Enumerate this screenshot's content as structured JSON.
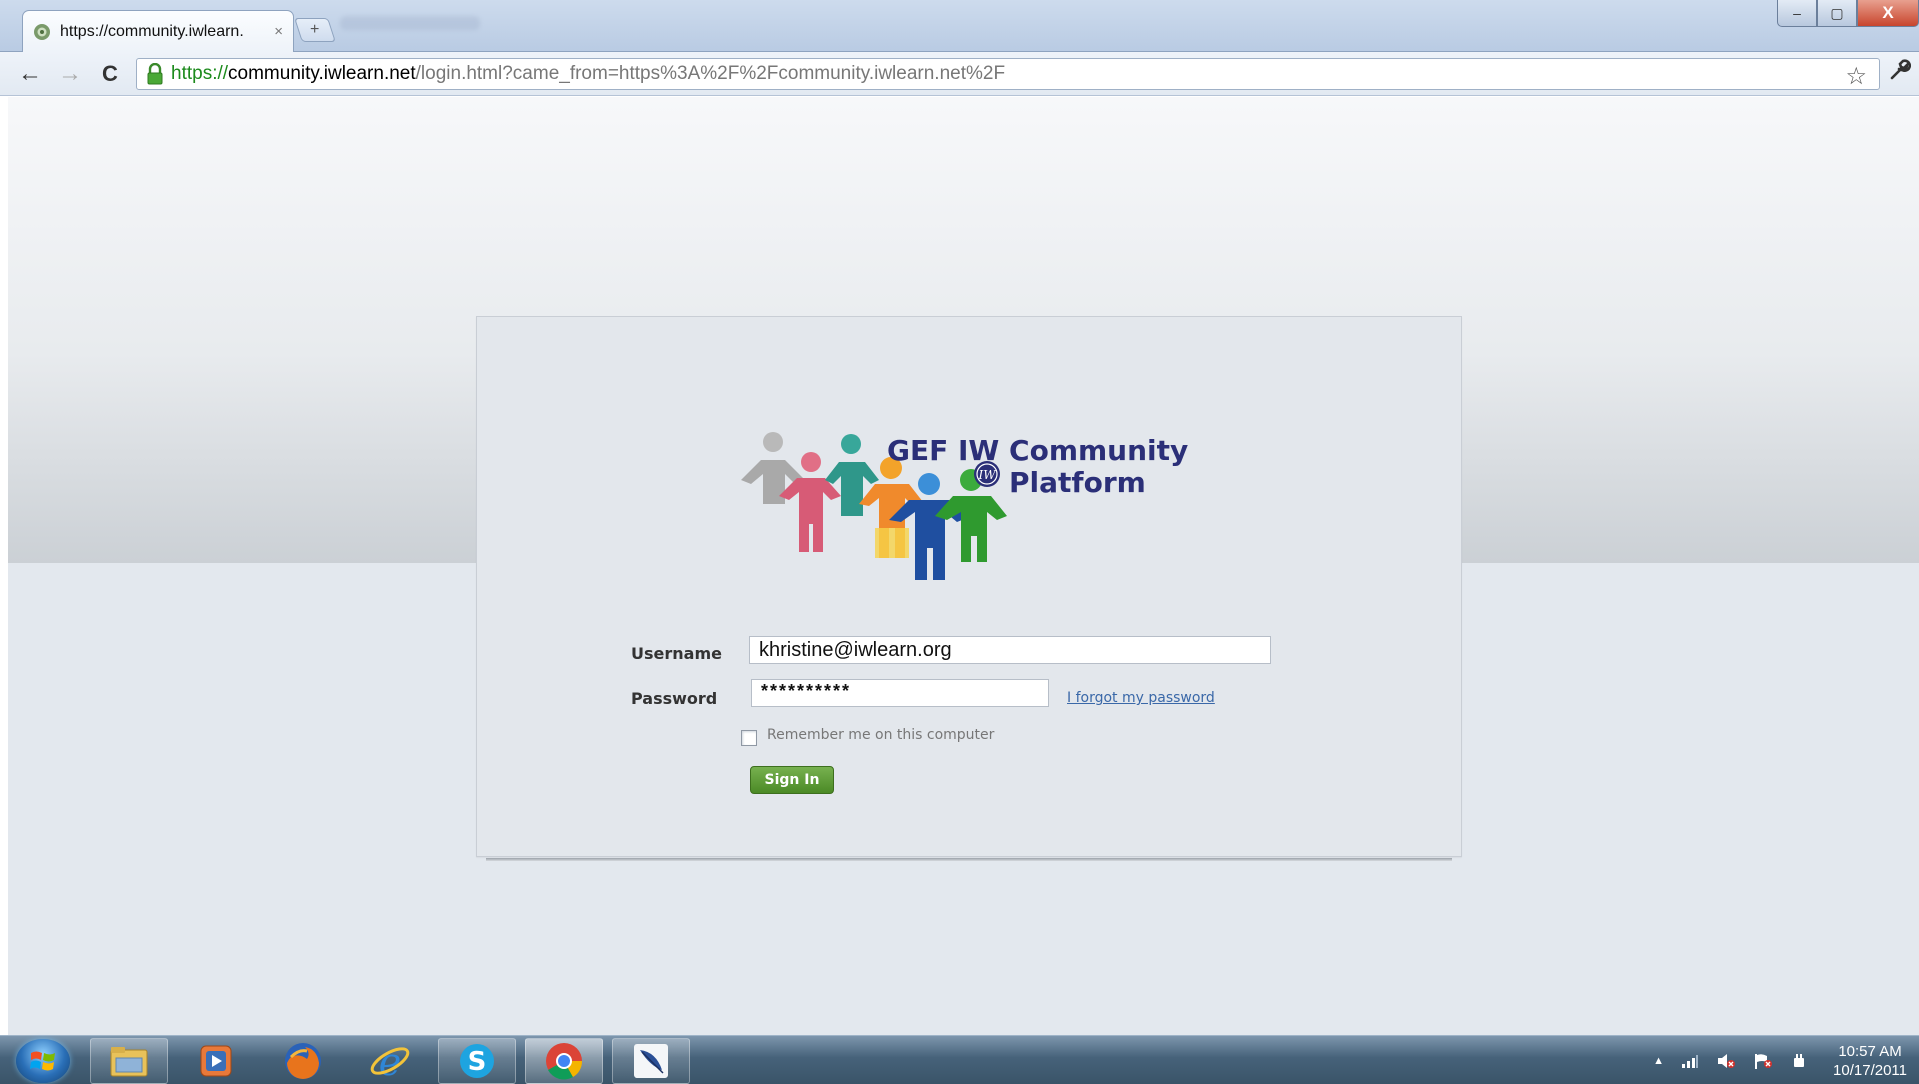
{
  "browser": {
    "tab_title": "https://community.iwlearn.",
    "tab_close": "×",
    "new_tab_symbol": "+",
    "url_scheme": "https://",
    "url_host": "community.iwlearn.net",
    "url_path": "/login.html?came_from=https%3A%2F%2Fcommunity.iwlearn.net%2F",
    "back_symbol": "←",
    "forward_symbol": "→",
    "reload_symbol": "C",
    "bookmark_symbol": "☆",
    "settings_symbol": "🔧",
    "minimize_symbol": "–",
    "maximize_symbol": "▢",
    "close_symbol": "X",
    "icons": [
      "site-favicon-icon",
      "lock-icon",
      "star-icon",
      "wrench-icon"
    ]
  },
  "login": {
    "logo_line1": "GEF IW Community",
    "logo_line2": "Platform",
    "logo_badge": "IW",
    "username_label": "Username",
    "username_value": "khristine@iwlearn.org",
    "password_label": "Password",
    "password_value": "**********",
    "forgot_link": "I forgot my password",
    "remember_label": "Remember me on this computer",
    "remember_checked": false,
    "sign_in_button": "Sign In"
  },
  "taskbar": {
    "apps": [
      "windows-explorer",
      "media-player",
      "firefox",
      "internet-explorer",
      "skype",
      "chrome",
      "feather-app"
    ],
    "tray_show_hidden": "▲",
    "time": "10:57 AM",
    "date": "10/17/2011"
  },
  "colors": {
    "logo_text": "#2b2f78",
    "sign_in": "#5a9a32",
    "link": "#3a68a8",
    "url_scheme": "#1c8a1c"
  }
}
